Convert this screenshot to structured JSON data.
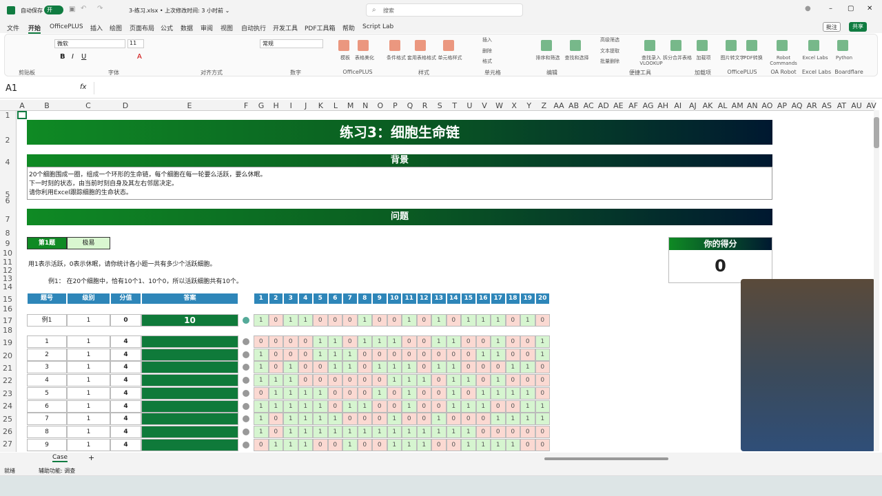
{
  "titlebar": {
    "autosave_label": "自动保存",
    "autosave_state": "开",
    "filename": "3-练习.xlsx • 上次修改时间: 3 小时前 ⌄",
    "search_placeholder": "搜索"
  },
  "menu": [
    "文件",
    "开始",
    "OfficePLUS",
    "插入",
    "绘图",
    "页面布局",
    "公式",
    "数据",
    "审阅",
    "视图",
    "自动执行",
    "开发工具",
    "PDF工具箱",
    "帮助",
    "Script Lab"
  ],
  "menu_right": {
    "comment": "批注",
    "share": "共享"
  },
  "ribbon": {
    "font_name": "微软",
    "font_size": "11",
    "number_format": "常规",
    "groups": [
      "剪贴板",
      "字体",
      "对齐方式",
      "数字",
      "OfficePLUS",
      "样式",
      "单元格",
      "编辑",
      "便捷工具",
      "加载项",
      "OfficePLUS",
      "OA Robot",
      "Excel Labs",
      "Boardflare"
    ],
    "buttons": [
      "模板",
      "表格美化",
      "条件格式",
      "套用表格格式",
      "单元格样式",
      "插入",
      "删除",
      "格式",
      "排序和筛选",
      "查找和选择",
      "高级筛选",
      "文本提取",
      "批量删除",
      "查找录入VLOOKUP",
      "拆分合并表格",
      "加载项",
      "图片转文字",
      "PDF转换",
      "Robot Commands",
      "Excel Labs",
      "Python"
    ]
  },
  "formula": {
    "namebox": "A1",
    "fx": "fx"
  },
  "columns": [
    "A",
    "B",
    "C",
    "D",
    "E",
    "F",
    "G",
    "H",
    "I",
    "J",
    "K",
    "L",
    "M",
    "N",
    "O",
    "P",
    "Q",
    "R",
    "S",
    "T",
    "U",
    "V",
    "W",
    "X",
    "Y",
    "Z",
    "AA",
    "AB",
    "AC",
    "AD",
    "AE",
    "AF",
    "AG",
    "AH",
    "AI",
    "AJ",
    "AK",
    "AL",
    "AM",
    "AN",
    "AO",
    "AP",
    "AQ",
    "AR",
    "AS",
    "AT",
    "AU",
    "AV"
  ],
  "rows": [
    "1",
    "2",
    "4",
    "5",
    "6",
    "7",
    "8",
    "9",
    "10",
    "11",
    "12",
    "13",
    "14",
    "15",
    "16",
    "17",
    "18",
    "19",
    "20",
    "21",
    "22",
    "23",
    "24",
    "25",
    "26",
    "27"
  ],
  "sheet": {
    "title": "练习3：细胞生命链",
    "background_header": "背景",
    "background_lines": [
      "20个细胞围成一圈，组成一个环形的生命链，每个细胞在每一轮要么活跃，要么休眠。",
      "下一时刻的状态，由当前时刻自身及其左右邻居决定。",
      "请你利用Excel跟踪细胞的生命状态。"
    ],
    "question_header": "问题",
    "question_no": "第1题",
    "difficulty": "极易",
    "instruction": "用1表示活跃，0表示休眠，请你统计各小题一共有多少个活跃细胞。",
    "example_text": "例1： 在20个细胞中，恰有10个1、10个0，所以活跃细胞共有10个。",
    "score_label": "你的得分",
    "score": "0",
    "table_headers": [
      "题号",
      "级别",
      "分值",
      "答案"
    ],
    "cell_headers": [
      "1",
      "2",
      "3",
      "4",
      "5",
      "6",
      "7",
      "8",
      "9",
      "10",
      "11",
      "12",
      "13",
      "14",
      "15",
      "16",
      "17",
      "18",
      "19",
      "20"
    ],
    "example": {
      "id": "例1",
      "level": "1",
      "points": "0",
      "answer": "10",
      "cells": "10110001001010111010"
    },
    "problems": [
      {
        "id": "1",
        "level": "1",
        "points": "4",
        "cells": "00001101110011001001"
      },
      {
        "id": "2",
        "level": "1",
        "points": "4",
        "cells": "10001110000000011001"
      },
      {
        "id": "3",
        "level": "1",
        "points": "4",
        "cells": "10100110111011000110"
      },
      {
        "id": "4",
        "level": "1",
        "points": "4",
        "cells": "11100000011101101000"
      },
      {
        "id": "5",
        "level": "1",
        "points": "4",
        "cells": "01111000101001011110"
      },
      {
        "id": "6",
        "level": "1",
        "points": "4",
        "cells": "11111011001001110011"
      },
      {
        "id": "7",
        "level": "1",
        "points": "4",
        "cells": "10111100010010001111"
      },
      {
        "id": "8",
        "level": "1",
        "points": "4",
        "cells": "10111111111111100000"
      },
      {
        "id": "9",
        "level": "1",
        "points": "4",
        "cells": "01110010011100111100"
      }
    ]
  },
  "sheet_tabs": {
    "active": "Case",
    "add": "+"
  },
  "status": {
    "ready": "就绪",
    "accessibility": "辅助功能: 调查"
  },
  "colors": {
    "accent": "#107c41",
    "header_blue": "#2e86b9",
    "active": "#d6f5d0",
    "inactive": "#fbd9d2"
  }
}
